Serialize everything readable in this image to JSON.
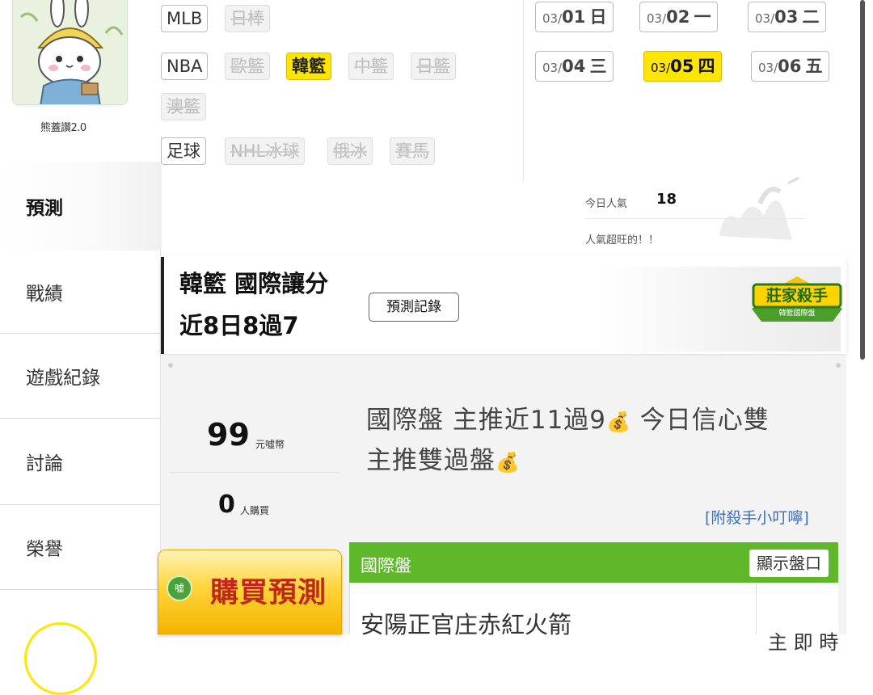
{
  "profile": {
    "name": "熊蓋讚2.0"
  },
  "sidebar": {
    "items": [
      {
        "label": "預測"
      },
      {
        "label": "戰績"
      },
      {
        "label": "遊戲紀錄"
      },
      {
        "label": "討論"
      },
      {
        "label": "榮譽"
      }
    ]
  },
  "leagues": {
    "row1": [
      {
        "label": "MLB"
      },
      {
        "label": "日棒"
      }
    ],
    "row2": [
      {
        "label": "NBA"
      },
      {
        "label": "歐籃"
      },
      {
        "label": "韓籃"
      },
      {
        "label": "中籃"
      },
      {
        "label": "日籃"
      }
    ],
    "row3": [
      {
        "label": "澳籃"
      }
    ],
    "row4": [
      {
        "label": "足球"
      },
      {
        "label": "NHL冰球"
      },
      {
        "label": "俄冰"
      },
      {
        "label": "賽馬"
      }
    ]
  },
  "dates": [
    {
      "month": "03/",
      "day": "01",
      "weekday": "日"
    },
    {
      "month": "03/",
      "day": "02",
      "weekday": "一"
    },
    {
      "month": "03/",
      "day": "03",
      "weekday": "二"
    },
    {
      "month": "03/",
      "day": "04",
      "weekday": "三"
    },
    {
      "month": "03/",
      "day": "05",
      "weekday": "四"
    },
    {
      "month": "03/",
      "day": "06",
      "weekday": "五"
    }
  ],
  "popularity": {
    "label": "今日人氣",
    "count": "18",
    "note": "人氣超旺的！！"
  },
  "prediction": {
    "title": "韓籃 國際讓分",
    "subtitle": "近8日8過7",
    "record_button": "預測記錄",
    "badge_line1": "莊家殺手",
    "badge_line2": "韓籃國際盤",
    "price": "99",
    "price_unit": "元噓幣",
    "buyers": "0",
    "buyers_unit": "人購買",
    "text_line1": "國際盤 主推近11過9",
    "text_line1b": " 今日信心雙",
    "text_line2": "主推雙過盤",
    "hint_link": "[附殺手小叮嚀]",
    "buy_coin": "噓",
    "buy_button": "購買預測"
  },
  "market": {
    "title": "國際盤",
    "show_button": "顯示盤口",
    "team": "安陽正官庄赤紅火箭",
    "cut_text": "主 即 時"
  },
  "colors": {
    "accent_yellow": "#ffe600",
    "green": "#5fb82a",
    "link_blue": "#3b6fbf"
  }
}
